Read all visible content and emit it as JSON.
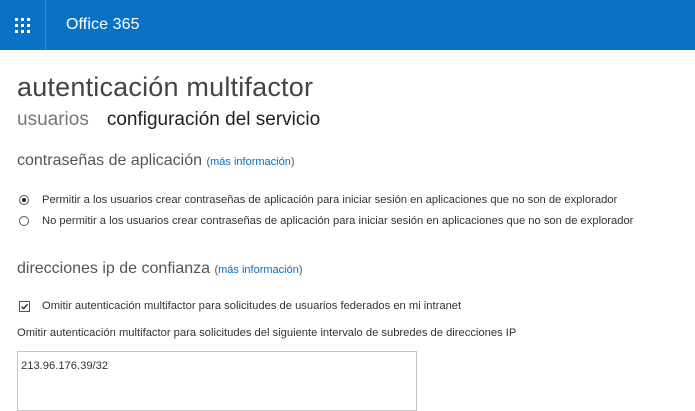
{
  "topbar": {
    "app_title": "Office 365",
    "color": "#0a72c6",
    "launcher_icon": "app-launcher-icon"
  },
  "page": {
    "title": "autenticación multifactor",
    "tabs": [
      {
        "label": "usuarios",
        "active": false
      },
      {
        "label": "configuración del servicio",
        "active": true
      }
    ]
  },
  "app_passwords": {
    "heading": "contraseñas de aplicación",
    "more_info": "más información",
    "options": [
      {
        "label": "Permitir a los usuarios crear contraseñas de aplicación para iniciar sesión en aplicaciones que no son de explorador",
        "selected": true
      },
      {
        "label": "No permitir a los usuarios crear contraseñas de aplicación para iniciar sesión en aplicaciones que no son de explorador",
        "selected": false
      }
    ]
  },
  "trusted_ips": {
    "heading": "direcciones ip de confianza",
    "more_info": "más información",
    "federated_checkbox": {
      "label": "Omitir autenticación multifactor para solicitudes de usuarios federados en mi intranet",
      "checked": true
    },
    "subnet_label": "Omitir autenticación multifactor para solicitudes del siguiente intervalo de subredes de direcciones IP",
    "subnet_value": "213.96.176.39/32"
  },
  "colors": {
    "link": "#0a6cc2",
    "text": "#333333"
  }
}
